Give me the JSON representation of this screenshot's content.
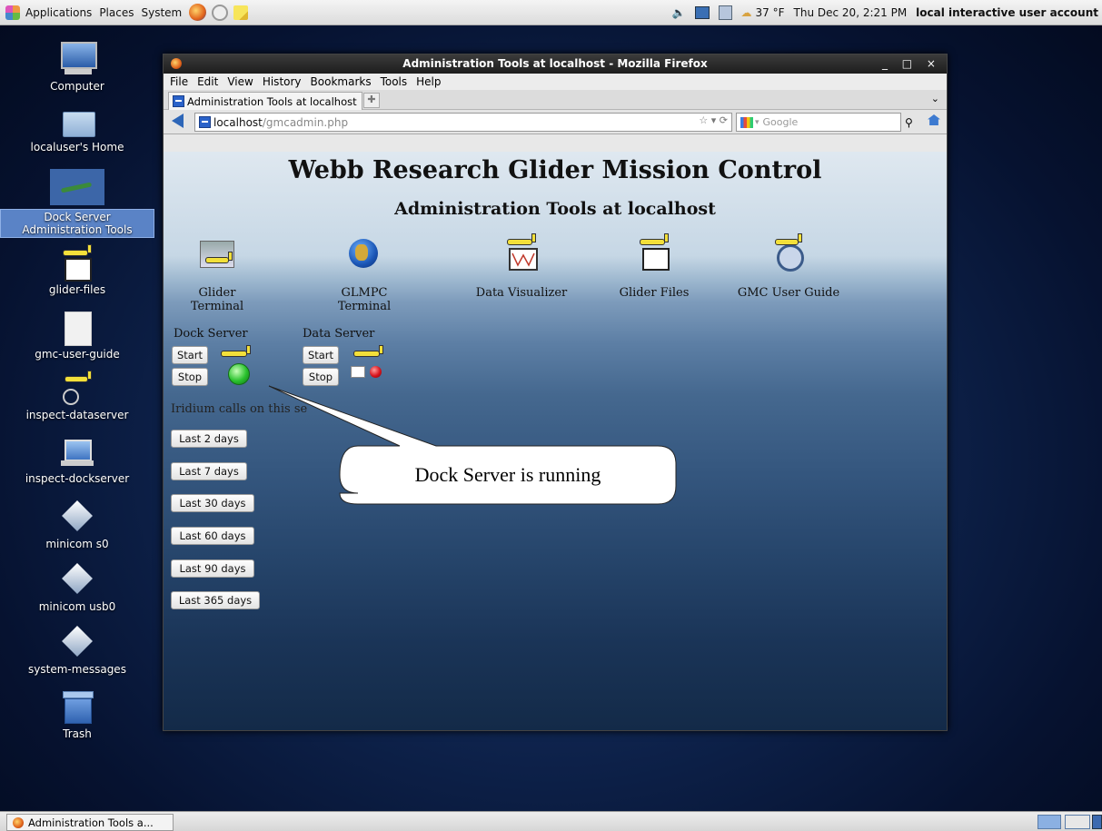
{
  "topbar": {
    "menus": [
      "Applications",
      "Places",
      "System"
    ],
    "weather": "37 °F",
    "datetime": "Thu Dec 20,  2:21 PM",
    "user": "local interactive user account"
  },
  "desktop_icons": [
    {
      "label": "Computer",
      "icon": "computer-icon"
    },
    {
      "label": "localuser's Home",
      "icon": "home-folder-icon"
    },
    {
      "label": "Dock Server Administration Tools",
      "icon": "glider-icon"
    },
    {
      "label": "glider-files",
      "icon": "glider-files-icon"
    },
    {
      "label": "gmc-user-guide",
      "icon": "document-icon"
    },
    {
      "label": "inspect-dataserver",
      "icon": "inspect-dataserver-icon"
    },
    {
      "label": "inspect-dockserver",
      "icon": "laptop-icon"
    },
    {
      "label": "minicom s0",
      "icon": "diamond-icon"
    },
    {
      "label": "minicom usb0",
      "icon": "diamond-icon"
    },
    {
      "label": "system-messages",
      "icon": "diamond-icon"
    },
    {
      "label": "Trash",
      "icon": "trash-icon"
    }
  ],
  "browser": {
    "title": "Administration Tools at localhost - Mozilla Firefox",
    "menu": [
      "File",
      "Edit",
      "View",
      "History",
      "Bookmarks",
      "Tools",
      "Help"
    ],
    "tab_label": "Administration Tools at localhost",
    "url_host": "localhost",
    "url_path": "/gmcadmin.php",
    "search_placeholder": "Google"
  },
  "page": {
    "heading": "Webb Research Glider Mission Control",
    "subheading": "Administration Tools at localhost",
    "tools": [
      {
        "label": "Glider Terminal",
        "icon": "glider-terminal-icon"
      },
      {
        "label": "GLMPC Terminal",
        "icon": "globe-icon"
      },
      {
        "label": "Data Visualizer",
        "icon": "data-visualizer-icon"
      },
      {
        "label": "Glider Files",
        "icon": "glider-files-icon"
      },
      {
        "label": "GMC User Guide",
        "icon": "compass-icon"
      }
    ],
    "dock_server": {
      "label": "Dock Server",
      "start": "Start",
      "stop": "Stop",
      "status": "running",
      "status_color": "#29c22d"
    },
    "data_server": {
      "label": "Data Server",
      "start": "Start",
      "stop": "Stop",
      "status": "stopped",
      "status_color": "#d8121b"
    },
    "iridium_label": "Iridium calls on this se",
    "period_buttons": [
      "Last 2 days",
      "Last 7 days",
      "Last 30 days",
      "Last 60 days",
      "Last 90 days",
      "Last 365 days"
    ],
    "callout": "Dock Server is running"
  },
  "taskbar": {
    "window_button": "Administration Tools a..."
  }
}
